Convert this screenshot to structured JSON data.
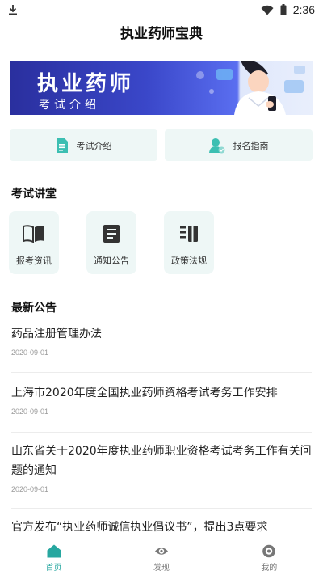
{
  "status_bar": {
    "time": "2:36"
  },
  "header": {
    "title": "执业药师宝典"
  },
  "banner": {
    "title": "执业药师",
    "subtitle": "考试介绍"
  },
  "quick_links": [
    {
      "label": "考试介绍",
      "icon": "document-icon"
    },
    {
      "label": "报名指南",
      "icon": "user-check-icon"
    }
  ],
  "lecture_section": {
    "title": "考试讲堂",
    "items": [
      {
        "label": "报考资讯",
        "icon": "book-icon"
      },
      {
        "label": "通知公告",
        "icon": "notice-icon"
      },
      {
        "label": "政策法规",
        "icon": "policy-icon"
      }
    ]
  },
  "notice_section": {
    "title": "最新公告",
    "items": [
      {
        "title": "药品注册管理办法",
        "date": "2020-09-01"
      },
      {
        "title": "上海市2020年度全国执业药师资格考试考务工作安排",
        "date": "2020-09-01"
      },
      {
        "title": "山东省关于2020年度执业药师职业资格考试考务工作有关问题的通知",
        "date": "2020-09-01"
      },
      {
        "title": "官方发布“执业药师诚信执业倡议书”，提出3点要求",
        "date": ""
      }
    ]
  },
  "bottom_nav": {
    "items": [
      {
        "label": "首页",
        "icon": "home-icon",
        "active": true
      },
      {
        "label": "发现",
        "icon": "eye-icon",
        "active": false
      },
      {
        "label": "我的",
        "icon": "profile-icon",
        "active": false
      }
    ]
  },
  "colors": {
    "accent": "#27a7a0",
    "tile_bg": "#eef7f6",
    "banner_blue": "#2a2f9e"
  }
}
